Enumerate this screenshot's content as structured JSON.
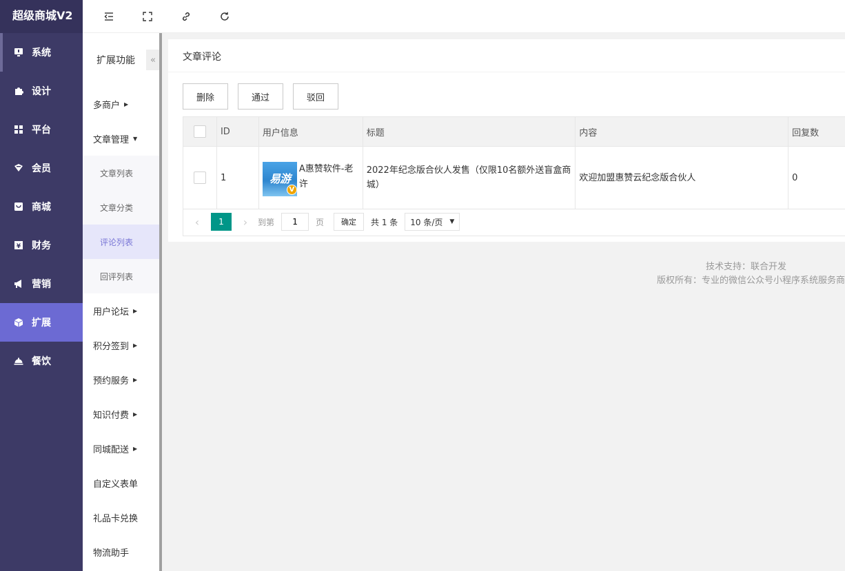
{
  "brand": "超级商城V2",
  "nav": [
    {
      "label": "系统",
      "icon": "monitor-icon"
    },
    {
      "label": "设计",
      "icon": "puzzle-icon"
    },
    {
      "label": "平台",
      "icon": "grid-icon"
    },
    {
      "label": "会员",
      "icon": "heart-icon"
    },
    {
      "label": "商城",
      "icon": "bag-icon"
    },
    {
      "label": "财务",
      "icon": "yen-icon"
    },
    {
      "label": "营销",
      "icon": "megaphone-icon"
    },
    {
      "label": "扩展",
      "icon": "cube-icon"
    },
    {
      "label": "餐饮",
      "icon": "dish-icon"
    }
  ],
  "sub": {
    "heading": "扩展功能",
    "collapse": "«",
    "items": {
      "merchant": "多商户",
      "article_mgmt": "文章管理",
      "article_list": "文章列表",
      "article_category": "文章分类",
      "comment_list": "评论列表",
      "reply_list": "回评列表",
      "forum": "用户论坛",
      "points_signin": "积分签到",
      "booking": "预约服务",
      "knowledge": "知识付费",
      "delivery": "同城配送",
      "custom_form": "自定义表单",
      "gift_card": "礼品卡兑换",
      "logistics": "物流助手"
    }
  },
  "card": {
    "title": "文章评论",
    "buttons": {
      "delete": "删除",
      "approve": "通过",
      "reject": "驳回"
    }
  },
  "table": {
    "headers": {
      "id": "ID",
      "user": "用户信息",
      "title": "标题",
      "content": "内容",
      "replies": "回复数"
    },
    "rows": [
      {
        "id": "1",
        "avatar_text": "易游",
        "avatar_badge": "V",
        "user": "A惠赞软件-老许",
        "title": "2022年纪念版合伙人发售（仅限10名额外送盲盒商城）",
        "content": "欢迎加盟惠赞云纪念版合伙人",
        "replies": "0"
      }
    ]
  },
  "pager": {
    "prev": "‹",
    "next": "›",
    "current": "1",
    "goto": "到第",
    "goto_value": "1",
    "page_unit": "页",
    "confirm": "确定",
    "total": "共 1 条",
    "per_page": "10 条/页"
  },
  "footer": {
    "support": "技术支持：联合开发",
    "copyright": "版权所有：专业的微信公众号小程序系统服务商"
  }
}
